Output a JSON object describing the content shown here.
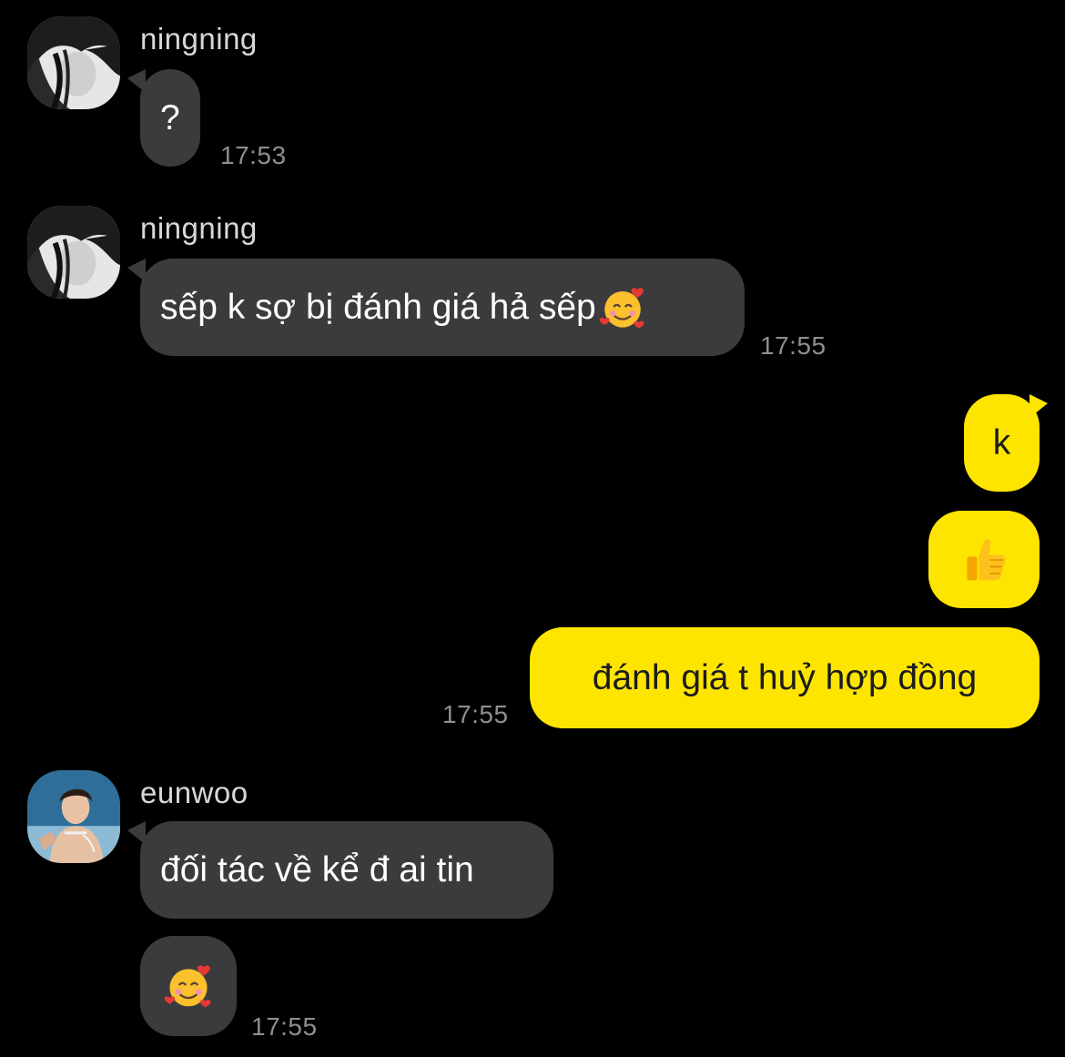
{
  "messages": [
    {
      "sender": "ningning",
      "text": "?",
      "time": "17:53"
    },
    {
      "sender": "ningning",
      "text": "sếp k sợ bị đánh giá hả sếp",
      "emoji": "smiling-face-with-hearts",
      "time": "17:55"
    },
    {
      "sender": "me",
      "text": "k"
    },
    {
      "sender": "me",
      "emoji": "thumbs-up"
    },
    {
      "sender": "me",
      "text": "đánh giá t huỷ hợp đồng",
      "time": "17:55"
    },
    {
      "sender": "eunwoo",
      "text": "đối tác về kể đ ai tin"
    },
    {
      "sender": "eunwoo",
      "emoji": "smiling-face-with-hearts",
      "time": "17:55"
    }
  ],
  "colors": {
    "background": "#000000",
    "incoming_bubble": "#3b3b3d",
    "outgoing_bubble": "#fee500",
    "timestamp": "#8e8e93"
  }
}
